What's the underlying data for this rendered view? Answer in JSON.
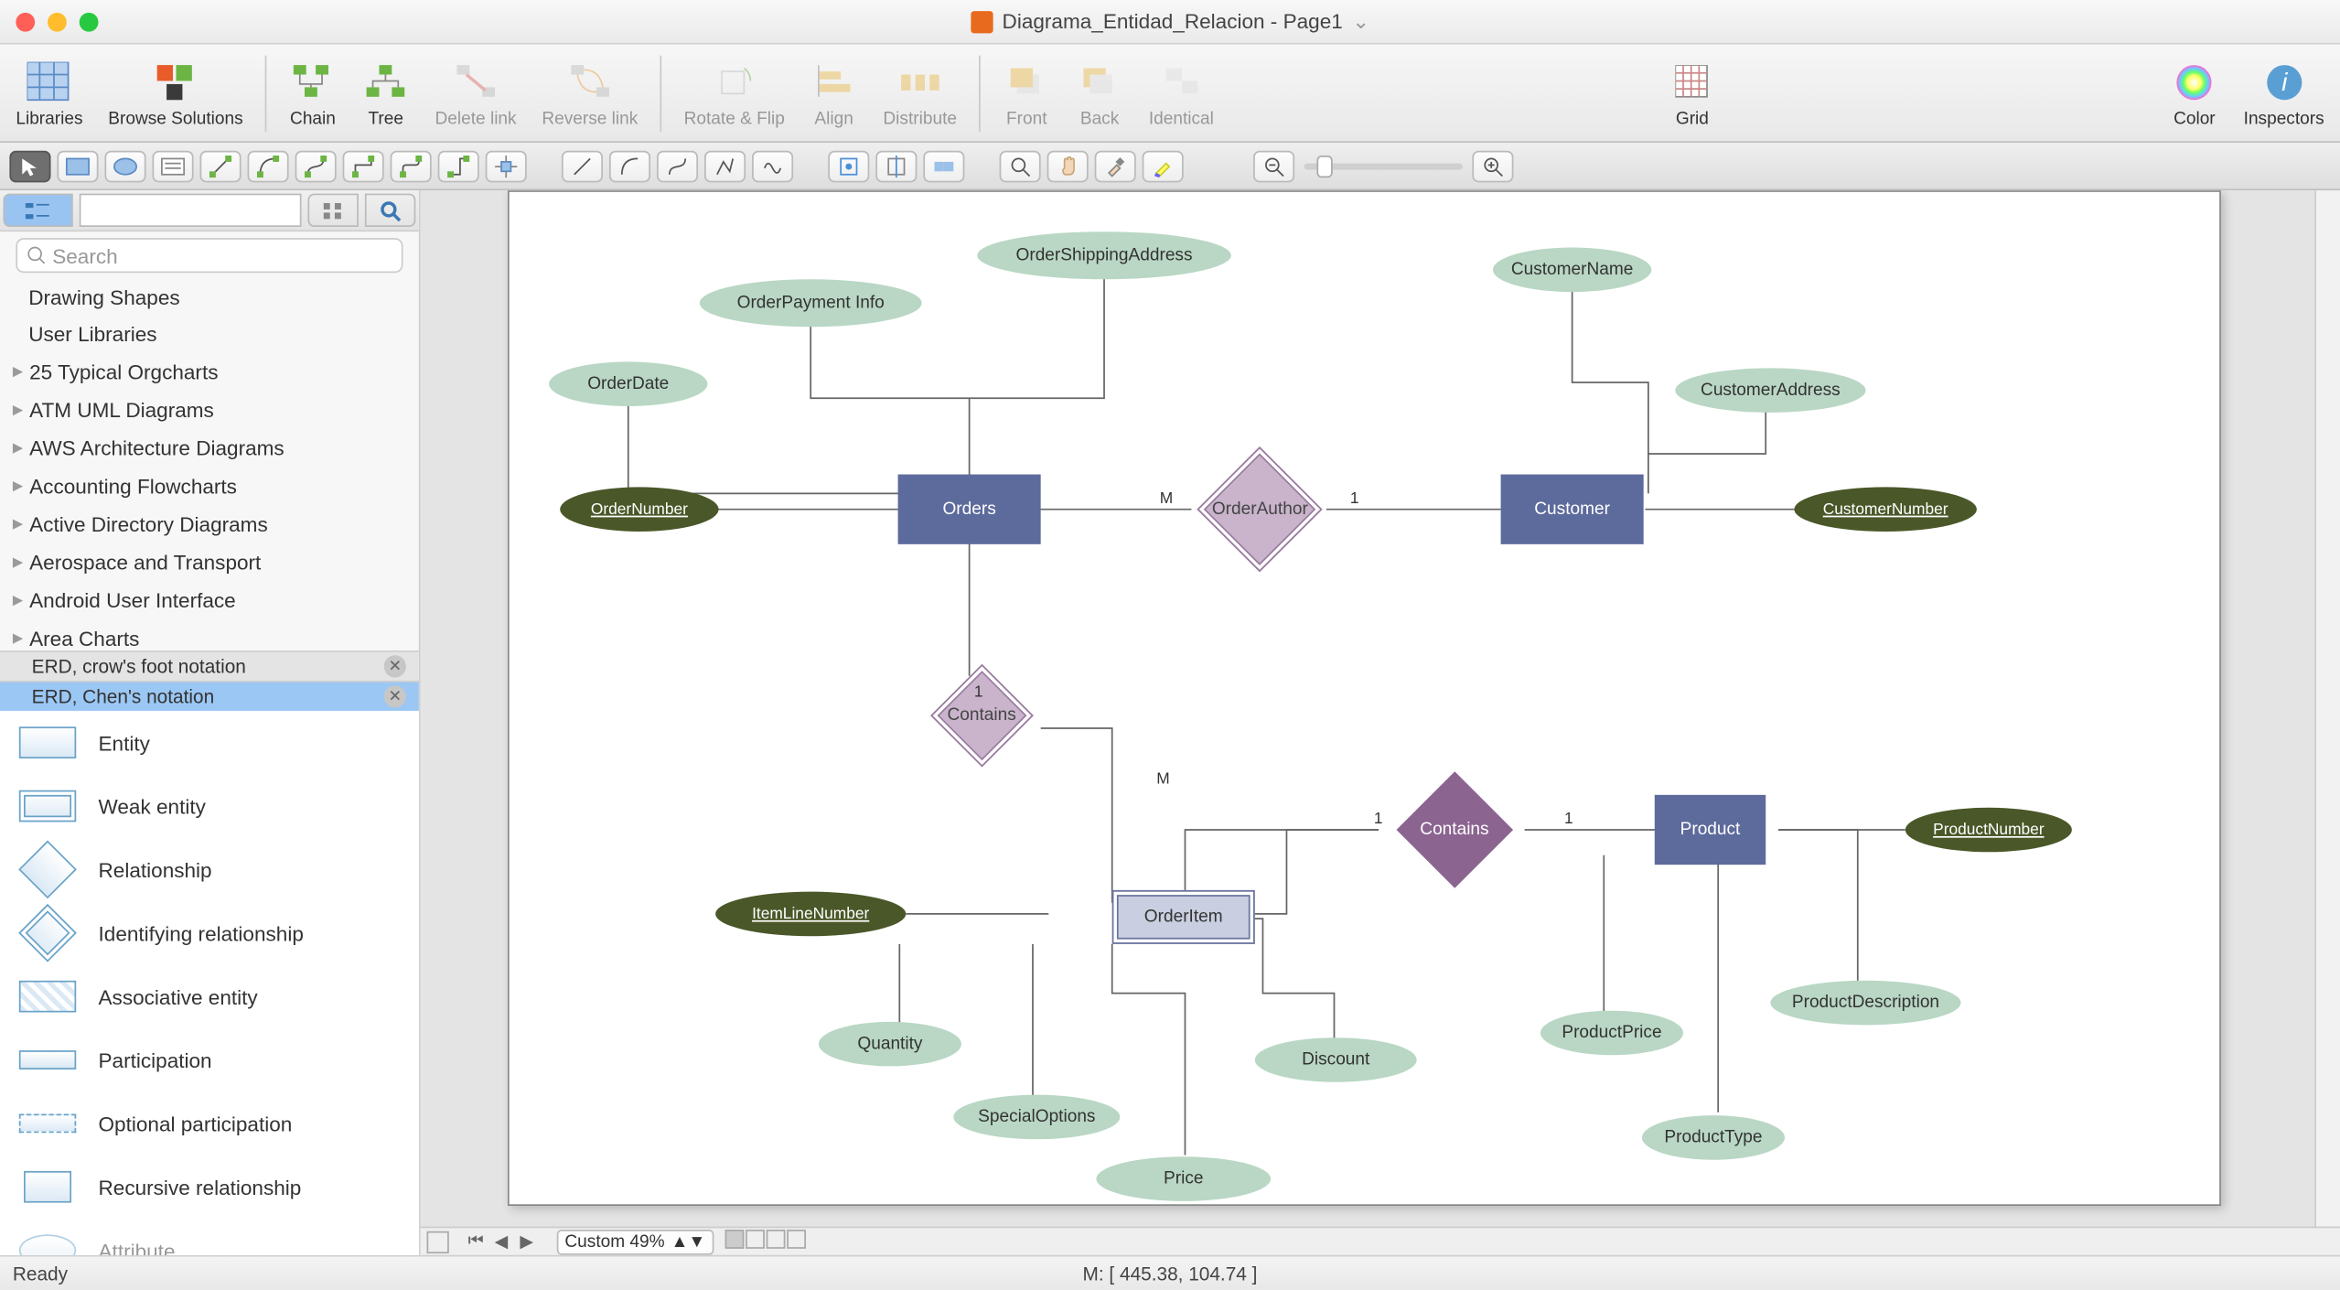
{
  "title": "Diagrama_Entidad_Relacion - Page1",
  "toolbar": {
    "libraries": "Libraries",
    "browse": "Browse Solutions",
    "chain": "Chain",
    "tree": "Tree",
    "delete_link": "Delete link",
    "reverse_link": "Reverse link",
    "rotate_flip": "Rotate & Flip",
    "align": "Align",
    "distribute": "Distribute",
    "front": "Front",
    "back": "Back",
    "identical": "Identical",
    "grid": "Grid",
    "color": "Color",
    "inspectors": "Inspectors"
  },
  "sidebar": {
    "search_placeholder": "Search",
    "categories": [
      "Drawing Shapes",
      "User Libraries",
      "25 Typical Orgcharts",
      "ATM UML Diagrams",
      "AWS Architecture Diagrams",
      "Accounting Flowcharts",
      "Active Directory Diagrams",
      "Aerospace and Transport",
      "Android User Interface",
      "Area Charts"
    ],
    "tabs": {
      "crow": "ERD, crow's foot notation",
      "chen": "ERD, Chen's notation"
    },
    "stencils": [
      "Entity",
      "Weak entity",
      "Relationship",
      "Identifying relationship",
      "Associative entity",
      "Participation",
      "Optional participation",
      "Recursive relationship",
      "Attribute"
    ]
  },
  "diagram": {
    "orders": "Orders",
    "customer": "Customer",
    "product": "Product",
    "orderitem": "OrderItem",
    "ordernumber": "OrderNumber",
    "customernumber": "CustomerNumber",
    "productnumber": "ProductNumber",
    "itemlinenumber": "ItemLineNumber",
    "orderdate": "OrderDate",
    "orderpayment": "OrderPayment Info",
    "ordershipping": "OrderShippingAddress",
    "customername": "CustomerName",
    "customeraddress": "CustomerAddress",
    "productprice": "ProductPrice",
    "producttype": "ProductType",
    "productdescription": "ProductDescription",
    "quantity": "Quantity",
    "specialoptions": "SpecialOptions",
    "price": "Price",
    "discount": "Discount",
    "orderauthor": "OrderAuthor",
    "contains1": "Contains",
    "contains2": "Contains",
    "card_m1": "M",
    "card_1a": "1",
    "card_1b": "1",
    "card_mb": "M",
    "card_1c": "1",
    "card_1d": "1"
  },
  "footer": {
    "zoom": "Custom 49%",
    "status_ready": "Ready",
    "mouse": "M: [ 445.38, 104.74 ]"
  }
}
